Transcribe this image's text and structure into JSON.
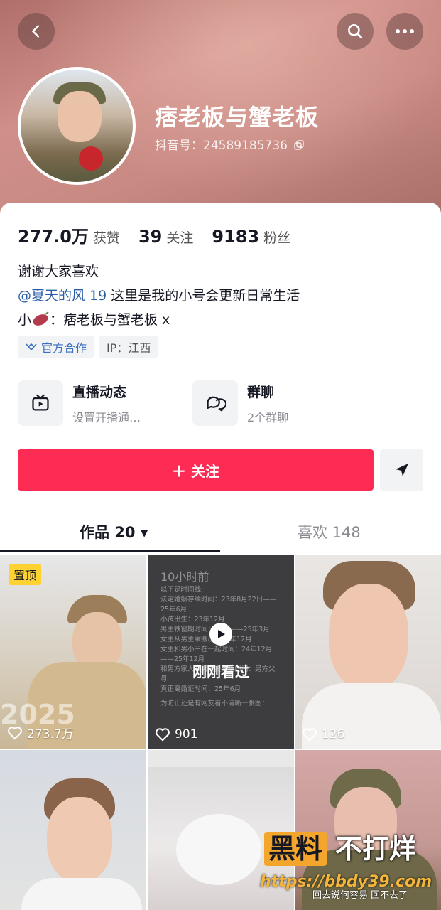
{
  "header": {
    "name": "痞老板与蟹老板",
    "douyin_id": "抖音号：24589185736"
  },
  "stats": [
    {
      "num": "277.0万",
      "label": "获赞"
    },
    {
      "num": "39",
      "label": "关注"
    },
    {
      "num": "9183",
      "label": "粉丝"
    }
  ],
  "bio": {
    "line1": "谢谢大家喜欢",
    "mention": "@夏天的风 19",
    "line2_rest": " 这里是我的小号会更新日常生活",
    "line3_prefix": "小",
    "line3_rest": "：痞老板与蟹老板 x"
  },
  "chips": {
    "official": "官方合作",
    "ip": "IP：江西"
  },
  "services": {
    "live": {
      "title": "直播动态",
      "sub": "设置开播通…"
    },
    "group": {
      "title": "群聊",
      "sub": "2个群聊"
    }
  },
  "follow_label": "＋ 关注",
  "tabs": {
    "works": "作品 20 ▾",
    "likes": "喜欢 148"
  },
  "videos": [
    {
      "likes": "273.7万",
      "pin": "置顶",
      "year": "2025"
    },
    {
      "likes": "901",
      "status": "刚刚看过",
      "doc_lines": [
        "10小时前",
        "以下是时间线:",
        "法定婚姻存续时间：23年8月22日——25年6月",
        "小孩出生：23年12月",
        "男主铁窗期时间：24年——25年3月",
        "女主从男主家搬出：24年12月",
        "女主和男小三在一起时间：24年12月——25年12月",
        "和男方家人及男主提离婚时间：男方父母",
        "真正离婚证时间：25年6月",
        "为防止还是有网友看不清晰一张图："
      ]
    },
    {
      "likes": "126"
    },
    {
      "likes": ""
    },
    {
      "likes": ""
    },
    {
      "likes": "",
      "caption": "回去说何容易 回不去了"
    }
  ],
  "watermark": {
    "black": "黑料",
    "rest": "不打烊",
    "url": "https://bbdy39.com"
  },
  "colors": {
    "accent": "#fe2c55",
    "mention": "#2a5ca8",
    "pin": "#fdd231"
  }
}
